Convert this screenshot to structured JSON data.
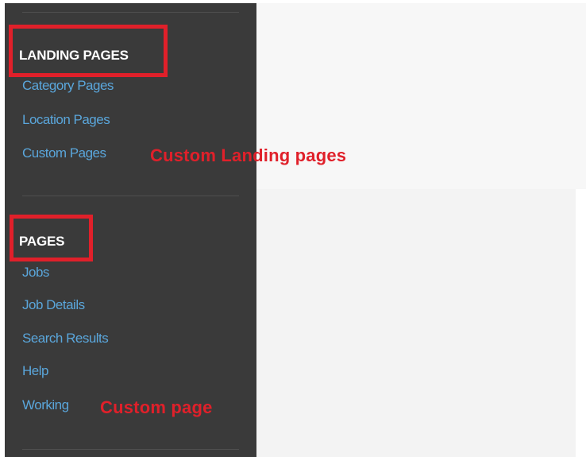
{
  "sidebar": {
    "landing_pages": {
      "heading": "LANDING PAGES",
      "links": [
        "Category Pages",
        "Location Pages",
        "Custom Pages"
      ]
    },
    "pages": {
      "heading": "PAGES",
      "links": [
        "Jobs",
        "Job Details",
        "Search Results",
        "Help",
        "Working"
      ]
    }
  },
  "annotations": {
    "custom_landing_pages": "Custom Landing pages",
    "custom_page": "Custom page"
  },
  "colors": {
    "sidebar_background": "#3a3a3a",
    "link": "#5aa6db",
    "annotation_red": "#e0202a"
  }
}
